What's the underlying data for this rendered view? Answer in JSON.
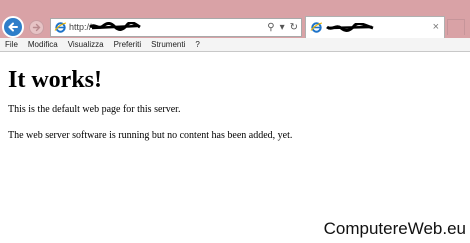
{
  "browser": {
    "address": {
      "prefix": "http://"
    },
    "address_tools": {
      "search": "⚲",
      "dropdown": "▾",
      "refresh": "↻"
    },
    "tab": {
      "close": "×"
    },
    "icons": [
      "back-arrow-icon",
      "forward-arrow-icon",
      "ie-logo-icon",
      "search-icon",
      "dropdown-icon",
      "refresh-icon",
      "close-icon"
    ]
  },
  "menu": [
    {
      "label": "File"
    },
    {
      "label": "Modifica"
    },
    {
      "label": "Visualizza"
    },
    {
      "label": "Preferiti"
    },
    {
      "label": "Strumenti"
    },
    {
      "label": "?"
    }
  ],
  "content": {
    "heading": "It works!",
    "paragraphs": [
      "This is the default web page for this server.",
      "The web server software is running but no content has been added, yet."
    ]
  },
  "watermark": "ComputereWeb.eu",
  "colors": {
    "chrome_background": "#d9a2a6",
    "back_button": "#2e7ec9",
    "ie_logo": "#1e73c8"
  }
}
